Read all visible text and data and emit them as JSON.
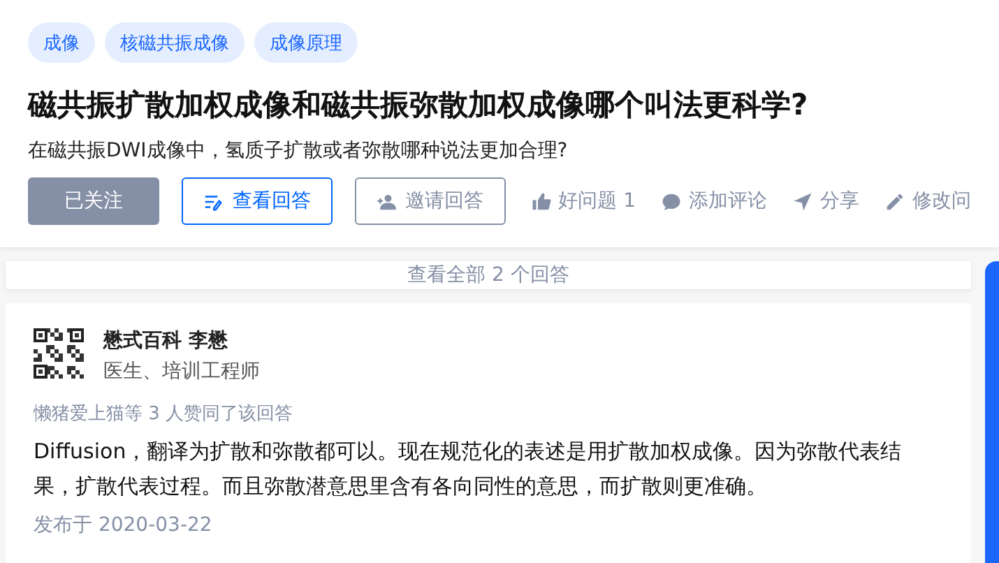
{
  "tags": [
    {
      "label": "成像"
    },
    {
      "label": "核磁共振成像"
    },
    {
      "label": "成像原理"
    }
  ],
  "title": "磁共振扩散加权成像和磁共振弥散加权成像哪个叫法更科学?",
  "detail": "在磁共振DWI成像中，氢质子扩散或者弥散哪种说法更加合理?",
  "buttons": [
    {
      "label": "已关注",
      "kind": "followed"
    },
    {
      "label": "查看回答",
      "kind": "primary"
    },
    {
      "label": "邀请回答",
      "kind": "outline"
    }
  ],
  "actions": [
    {
      "label": "好问题 1",
      "kind": "like"
    },
    {
      "label": "添加评论",
      "kind": "comment"
    },
    {
      "label": "分享",
      "kind": "share"
    },
    {
      "label": "修改问",
      "kind": "edit"
    }
  ],
  "view_all": "查看全部 2 个回答",
  "answer": {
    "author": "懋式百科 李懋",
    "bio": "医生、培训工程师",
    "voters": "懒猪爱上猫等 3 人赞同了该回答",
    "content": "Diffusion，翻译为扩散和弥散都可以。现在规范化的表述是用扩散加权成像。因为弥散代表结果，扩散代表过程。而且弥散潜意思里含有各向同性的意思，而扩散则更准确。",
    "date": "发布于 2020-03-22"
  }
}
